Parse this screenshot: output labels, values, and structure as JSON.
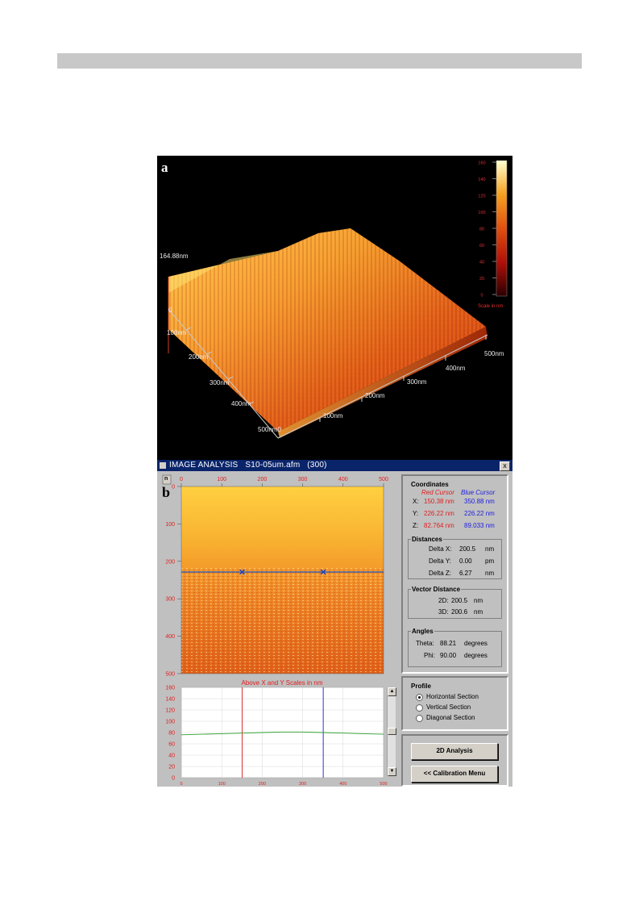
{
  "panel_a": {
    "letter": "a",
    "height_label": "164.88nm",
    "left_axis": [
      "0",
      "100nm",
      "200nm",
      "300nm",
      "400nm",
      "500nm0"
    ],
    "right_axis": [
      "100nm",
      "200nm",
      "300nm",
      "400nm",
      "500nm"
    ],
    "colorbar_ticks": [
      "160",
      "140",
      "120",
      "100",
      "80",
      "60",
      "40",
      "20",
      "0"
    ],
    "colorbar_caption": "Scale in nm"
  },
  "window": {
    "title": "IMAGE ANALYSIS   S10-05um.afm   (300)",
    "close_label": "x",
    "letter": "b",
    "corner_label": "n",
    "image_x_ticks": [
      "0",
      "100",
      "200",
      "300",
      "400",
      "500"
    ],
    "image_y_ticks": [
      "0",
      "100",
      "200",
      "300",
      "400",
      "500"
    ],
    "profile_caption": "Above X and Y Scales in nm",
    "profile_y_ticks": [
      "160",
      "140",
      "120",
      "100",
      "80",
      "60",
      "40",
      "20",
      "0"
    ],
    "profile_x_ticks": [
      "0",
      "100",
      "200",
      "300",
      "400",
      "500"
    ],
    "scroll_up": "▲",
    "scroll_down": "▼"
  },
  "chart_data": {
    "type": "line",
    "title": "Above X and Y Scales in nm",
    "x": [
      0,
      50,
      100,
      150,
      200,
      250,
      300,
      350,
      400,
      450,
      500
    ],
    "series": [
      {
        "values": [
          76,
          77,
          78,
          79,
          80,
          81,
          81,
          80,
          79,
          78,
          77
        ]
      }
    ],
    "xlim": [
      0,
      500
    ],
    "ylim": [
      0,
      160
    ],
    "red_cursor_x": 150.38,
    "blue_cursor_x": 350.88,
    "grid": true,
    "colors": {
      "line": "#2ea02e",
      "red_cursor": "#e03030",
      "blue_cursor": "#3030e0"
    }
  },
  "coordinates": {
    "title": "Coordinates",
    "red_header": "Red Cursor",
    "blue_header": "Blue Cursor",
    "rows": [
      {
        "axis": "X:",
        "red": "150.38 nm",
        "blue": "350.88 nm"
      },
      {
        "axis": "Y:",
        "red": "226.22 nm",
        "blue": "226.22 nm"
      },
      {
        "axis": "Z:",
        "red": "82.764 nm",
        "blue": "89.033 nm"
      }
    ]
  },
  "distances": {
    "title": "Distances",
    "rows": [
      {
        "label": "Delta X:",
        "value": "200.5",
        "unit": "nm"
      },
      {
        "label": "Delta Y:",
        "value": "0.00",
        "unit": "pm"
      },
      {
        "label": "Delta Z:",
        "value": "6.27",
        "unit": "nm"
      }
    ]
  },
  "vector": {
    "title": "Vector Distance",
    "rows": [
      {
        "label": "2D:",
        "value": "200.5",
        "unit": "nm"
      },
      {
        "label": "3D:",
        "value": "200.6",
        "unit": "nm"
      }
    ]
  },
  "angles": {
    "title": "Angles",
    "rows": [
      {
        "label": "Theta:",
        "value": "88.21",
        "unit": "degrees"
      },
      {
        "label": "Phi:",
        "value": "90.00",
        "unit": "degrees"
      }
    ]
  },
  "profile": {
    "title": "Profile",
    "options": [
      "Horizontal Section",
      "Vertical Section",
      "Diagonal Section"
    ],
    "selected": "Horizontal Section"
  },
  "buttons": {
    "analysis": "2D Analysis",
    "calibration": "<< Calibration Menu"
  },
  "colors": {
    "window_bg": "#c0c0c0",
    "titlebar": "#0a246a",
    "red": "#e02020",
    "blue": "#2020e0"
  }
}
